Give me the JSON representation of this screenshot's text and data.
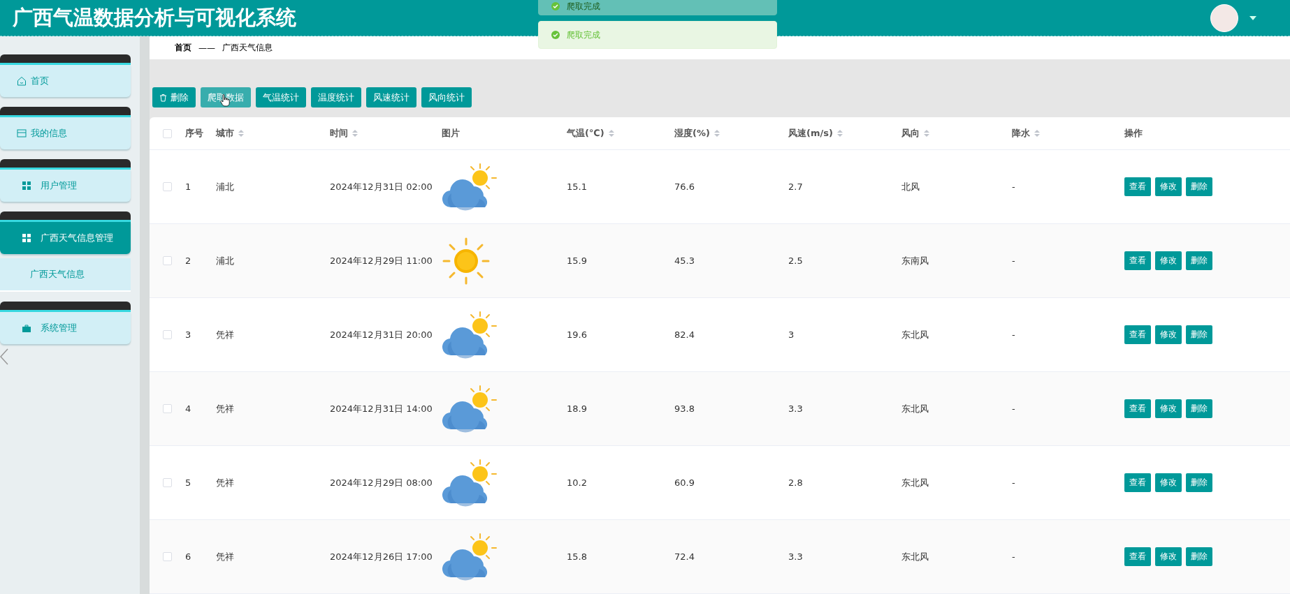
{
  "header": {
    "title": "广西气温数据分析与可视化系统"
  },
  "notifications": [
    {
      "text": "爬取完成",
      "faded": true
    },
    {
      "text": "爬取完成",
      "faded": false
    }
  ],
  "sidebar": {
    "items": [
      {
        "label": "首页",
        "selected": false
      },
      {
        "label": "我的信息",
        "selected": false
      },
      {
        "label": "用户管理",
        "selected": false
      },
      {
        "label": "广西天气信息管理",
        "selected": true,
        "children": [
          {
            "label": "广西天气信息",
            "selected": false
          }
        ]
      },
      {
        "label": "系统管理",
        "selected": false
      }
    ]
  },
  "breadcrumb": {
    "home": "首页",
    "separator": "——",
    "current": "广西天气信息"
  },
  "toolbar": [
    {
      "label": "删除",
      "hovered": false
    },
    {
      "label": "爬取数据",
      "hovered": true
    },
    {
      "label": "气温统计",
      "hovered": false
    },
    {
      "label": "温度统计",
      "hovered": false
    },
    {
      "label": "风速统计",
      "hovered": false
    },
    {
      "label": "风向统计",
      "hovered": false
    }
  ],
  "table": {
    "all_checked": false,
    "columns": [
      {
        "label": "序号",
        "sortable": false
      },
      {
        "label": "城市",
        "sortable": true
      },
      {
        "label": "时间",
        "sortable": true
      },
      {
        "label": "图片",
        "sortable": false
      },
      {
        "label": "气温(℃)",
        "sortable": true
      },
      {
        "label": "湿度(%)",
        "sortable": true
      },
      {
        "label": "风速(m/s)",
        "sortable": true
      },
      {
        "label": "风向",
        "sortable": true
      },
      {
        "label": "降水",
        "sortable": true
      },
      {
        "label": "操作",
        "sortable": false
      }
    ],
    "rows": [
      {
        "checked": false,
        "index": "1",
        "city": "浦北",
        "time": "2024年12月31日 02:00",
        "kind": "partly-cloudy",
        "temp": "15.1",
        "humidity": "76.6",
        "wind_speed": "2.7",
        "wind_dir": "北风",
        "rain": "-",
        "actions": [
          "查看",
          "修改",
          "删除"
        ]
      },
      {
        "checked": false,
        "index": "2",
        "city": "浦北",
        "time": "2024年12月29日 11:00",
        "kind": "sunny",
        "temp": "15.9",
        "humidity": "45.3",
        "wind_speed": "2.5",
        "wind_dir": "东南风",
        "rain": "-",
        "actions": [
          "查看",
          "修改",
          "删除"
        ]
      },
      {
        "checked": false,
        "index": "3",
        "city": "凭祥",
        "time": "2024年12月31日 20:00",
        "kind": "partly-cloudy",
        "temp": "19.6",
        "humidity": "82.4",
        "wind_speed": "3",
        "wind_dir": "东北风",
        "rain": "-",
        "actions": [
          "查看",
          "修改",
          "删除"
        ]
      },
      {
        "checked": false,
        "index": "4",
        "city": "凭祥",
        "time": "2024年12月31日 14:00",
        "kind": "partly-cloudy",
        "temp": "18.9",
        "humidity": "93.8",
        "wind_speed": "3.3",
        "wind_dir": "东北风",
        "rain": "-",
        "actions": [
          "查看",
          "修改",
          "删除"
        ]
      },
      {
        "checked": false,
        "index": "5",
        "city": "凭祥",
        "time": "2024年12月29日 08:00",
        "kind": "partly-cloudy",
        "temp": "10.2",
        "humidity": "60.9",
        "wind_speed": "2.8",
        "wind_dir": "东北风",
        "rain": "-",
        "actions": [
          "查看",
          "修改",
          "删除"
        ]
      },
      {
        "checked": false,
        "index": "6",
        "city": "凭祥",
        "time": "2024年12月26日 17:00",
        "kind": "partly-cloudy",
        "temp": "15.8",
        "humidity": "72.4",
        "wind_speed": "3.3",
        "wind_dir": "东北风",
        "rain": "-",
        "actions": [
          "查看",
          "修改",
          "删除"
        ]
      }
    ]
  }
}
